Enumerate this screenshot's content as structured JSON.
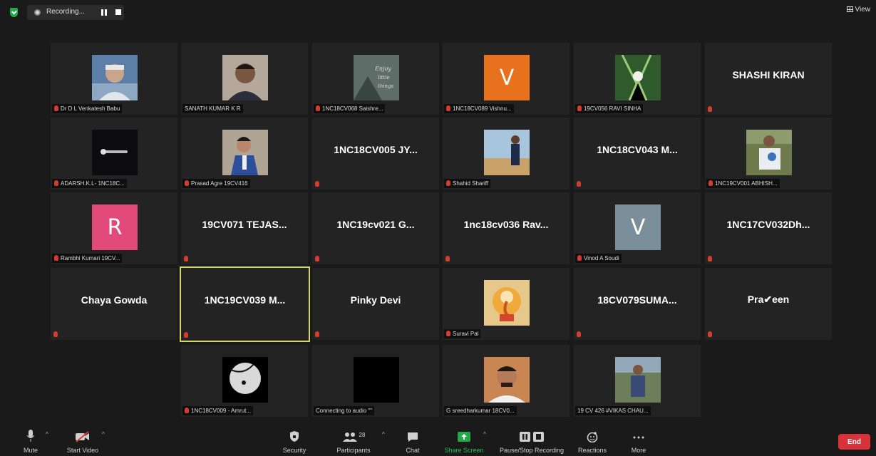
{
  "topbar": {
    "recording_label": "Recording...",
    "view_label": "View"
  },
  "tiles": [
    {
      "label": "Dr D L Venkatesh Babu",
      "big": ""
    },
    {
      "label": "SANATH KUMAR K R",
      "big": ""
    },
    {
      "label": "1NC18CV068 Saishre...",
      "big": ""
    },
    {
      "label": "1NC18CV089 Vishnu...",
      "big": "",
      "letter": "V"
    },
    {
      "label": "19CV056 RAVI SINHA",
      "big": ""
    },
    {
      "label": "",
      "big": "SHASHI KIRAN"
    },
    {
      "label": "ADARSH.K.L- 1NC18C...",
      "big": ""
    },
    {
      "label": "Prasad Agre 19CV416",
      "big": ""
    },
    {
      "label": "",
      "big": "1NC18CV005 JY..."
    },
    {
      "label": "Shahid Shariff",
      "big": ""
    },
    {
      "label": "",
      "big": "1NC18CV043 M..."
    },
    {
      "label": "1NC19CV001 ABHISH...",
      "big": ""
    },
    {
      "label": "Rambhi Kumari 19CV...",
      "big": "",
      "letter": "R"
    },
    {
      "label": "",
      "big": "19CV071 TEJAS..."
    },
    {
      "label": "",
      "big": "1NC19cv021 G..."
    },
    {
      "label": "",
      "big": "1nc18cv036 Rav..."
    },
    {
      "label": "Vinod A Soudi",
      "big": "",
      "letter": "V"
    },
    {
      "label": "",
      "big": "1NC17CV032Dh..."
    },
    {
      "label": "",
      "big": "Chaya Gowda"
    },
    {
      "label": "",
      "big": "1NC19CV039 M..."
    },
    {
      "label": "",
      "big": "Pinky Devi"
    },
    {
      "label": "Suravi Pal",
      "big": ""
    },
    {
      "label": "",
      "big": "18CV079SUMA..."
    },
    {
      "label": "",
      "big": "Pra✔een"
    },
    {
      "label": "1NC18CV009 - Amrut...",
      "big": ""
    },
    {
      "label": "Connecting to audio \"\"",
      "big": ""
    },
    {
      "label": "G sreedharkumar 18CV0...",
      "big": ""
    },
    {
      "label": "19 CV 426 #VIKAS CHAU...",
      "big": ""
    }
  ],
  "toolbar": {
    "mute": "Mute",
    "start_video": "Start Video",
    "security": "Security",
    "participants": "Participants",
    "participants_count": "28",
    "chat": "Chat",
    "share_screen": "Share Screen",
    "pause_stop_recording": "Pause/Stop Recording",
    "reactions": "Reactions",
    "more": "More",
    "end": "End"
  },
  "colors": {
    "accent_green": "#23a94a",
    "end_red": "#d8323a",
    "active_border": "#d4d56a",
    "muted_red": "#d43d2e"
  }
}
